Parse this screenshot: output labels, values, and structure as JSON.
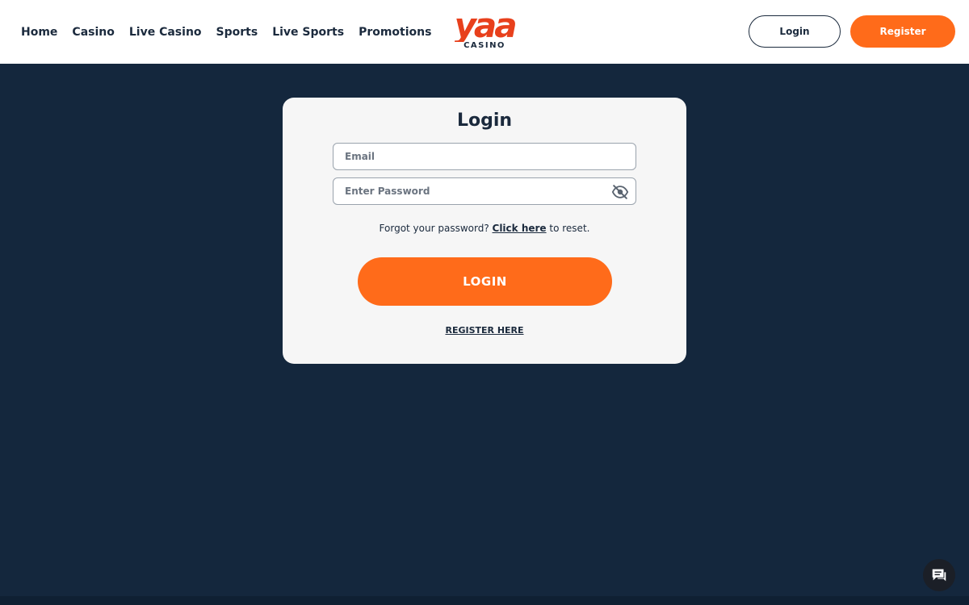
{
  "nav": {
    "items": [
      {
        "label": "Home"
      },
      {
        "label": "Casino"
      },
      {
        "label": "Live Casino"
      },
      {
        "label": "Sports"
      },
      {
        "label": "Live Sports"
      },
      {
        "label": "Promotions"
      }
    ]
  },
  "logo": {
    "mark_text": "yaa",
    "sub_text": "CASINO",
    "icon": "yaa-casino-logo"
  },
  "header": {
    "login_label": "Login",
    "register_label": "Register"
  },
  "login_form": {
    "title": "Login",
    "email_placeholder": "Email",
    "email_value": "",
    "password_placeholder": "Enter Password",
    "password_value": "",
    "forgot_prefix": "Forgot your password?",
    "forgot_link": "Click here",
    "forgot_suffix": "to reset.",
    "submit_label": "LOGIN",
    "register_link": "REGISTER HERE",
    "password_toggle_icon": "eye-off-icon"
  },
  "chat": {
    "icon": "chat-icon"
  },
  "colors": {
    "accent": "#ff6b1a",
    "logo_red": "#e8401c",
    "background": "#14273d",
    "card": "#f6f6f6",
    "text_dark": "#1b2a3d"
  }
}
